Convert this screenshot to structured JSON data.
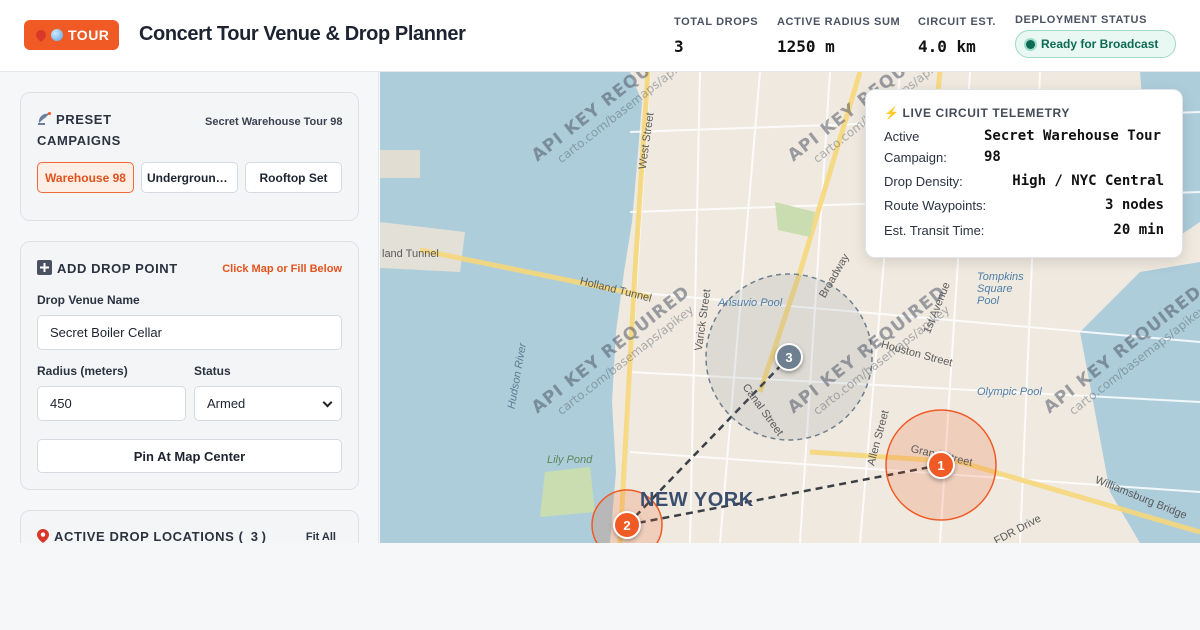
{
  "header": {
    "brand_label": "TOUR",
    "title": "Concert Tour Venue & Drop Planner",
    "stats": [
      {
        "label": "TOTAL DROPS",
        "value": "3"
      },
      {
        "label": "ACTIVE RADIUS SUM",
        "value": "1250 m"
      },
      {
        "label": "CIRCUIT EST.",
        "value": "4.0 km"
      }
    ],
    "deployment_label": "DEPLOYMENT STATUS",
    "deployment_status": "Ready for Broadcast",
    "colors": {
      "accent": "#f05a24",
      "status_green": "#0d6b55"
    }
  },
  "sidebar": {
    "presets": {
      "title": "PRESET CAMPAIGNS",
      "icon": "satellite-dish-icon",
      "current": "Secret Warehouse Tour 98",
      "buttons": [
        "Warehouse 98",
        "Underground...",
        "Rooftop Set"
      ]
    },
    "add_drop": {
      "title": "ADD DROP POINT",
      "icon": "plus-icon",
      "hint": "Click Map or Fill Below",
      "venue_label": "Drop Venue Name",
      "venue_value": "Secret Boiler Cellar",
      "radius_label": "Radius (meters)",
      "radius_value": "450",
      "status_label": "Status",
      "status_value": "Armed",
      "pin_button": "Pin At Map Center"
    },
    "active": {
      "title_prefix": "ACTIVE DROP LOCATIONS (",
      "count": "3",
      "title_suffix": ")",
      "icon": "map-pin-icon",
      "fit_all": "Fit All"
    }
  },
  "telemetry": {
    "title": "LIVE CIRCUIT TELEMETRY",
    "icon": "lightning-icon",
    "rows": [
      {
        "key": "Active Campaign:",
        "value": "Secret Warehouse Tour 98"
      },
      {
        "key": "Drop Density:",
        "value": "High / NYC Central"
      },
      {
        "key": "Route Waypoints:",
        "value": "3 nodes"
      },
      {
        "key": "Est. Transit Time:",
        "value": "20 min"
      }
    ]
  },
  "map": {
    "watermark": "API KEY REQUIRED",
    "watermark_sub": "carto.com/basemaps/apikey",
    "city_label": "NEW YORK",
    "markers": [
      "1",
      "2",
      "3"
    ],
    "labels": {
      "holland_tunnel": "Holland Tunnel",
      "hudson_river": "Hudson River",
      "west_street": "West Street",
      "varick_street": "Varick Street",
      "canal_street": "Canal Street",
      "houston_street": "Houston Street",
      "allen_street": "Allen Street",
      "broadway": "Broadway",
      "grand_street": "Grand Street",
      "fdr_drive": "FDR Drive",
      "williamsburg_bridge": "Williamsburg Bridge",
      "lily_pond": "Lily Pond",
      "first_avenue": "1st Avenue",
      "tompkins_square": "Tompkins Square Pool",
      "olympic_pool": "Olympic Pool",
      "ansuvio_pool": "Ansuvio Pool",
      "land_tunnel": "land Tunnel"
    }
  }
}
